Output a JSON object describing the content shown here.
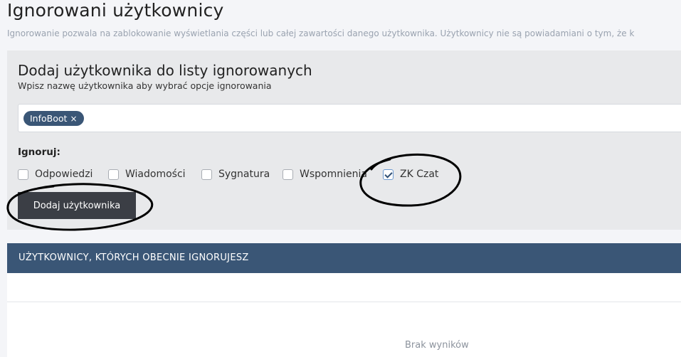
{
  "page": {
    "title": "Ignorowani użytkownicy",
    "description": "Ignorowanie pozwala na zablokowanie wyświetlania części lub całej zawartości danego użytkownika. Użytkownicy nie są powiadamiani o tym, że k"
  },
  "add_form": {
    "title": "Dodaj użytkownika do listy ignorowanych",
    "subtitle": "Wpisz nazwę użytkownika aby wybrać opcje ignorowania",
    "tags": [
      {
        "label": "InfoBoot",
        "remove": "×"
      }
    ],
    "ignore_label": "Ignoruj:",
    "options": [
      {
        "label": "Odpowiedzi",
        "checked": false
      },
      {
        "label": "Wiadomości",
        "checked": false
      },
      {
        "label": "Sygnatura",
        "checked": false
      },
      {
        "label": "Wspomnienia",
        "checked": false
      },
      {
        "label": "ZK Czat",
        "checked": true
      }
    ],
    "submit_label": "Dodaj użytkownika"
  },
  "ignored_list": {
    "header": "UŻYTKOWNICY, KTÓRYCH OBECNIE IGNORUJESZ",
    "empty_text": "Brak wyników"
  },
  "colors": {
    "accent": "#3a5676",
    "button": "#3b3e45",
    "panel": "#e8e9eb",
    "annotation": "#000000"
  }
}
